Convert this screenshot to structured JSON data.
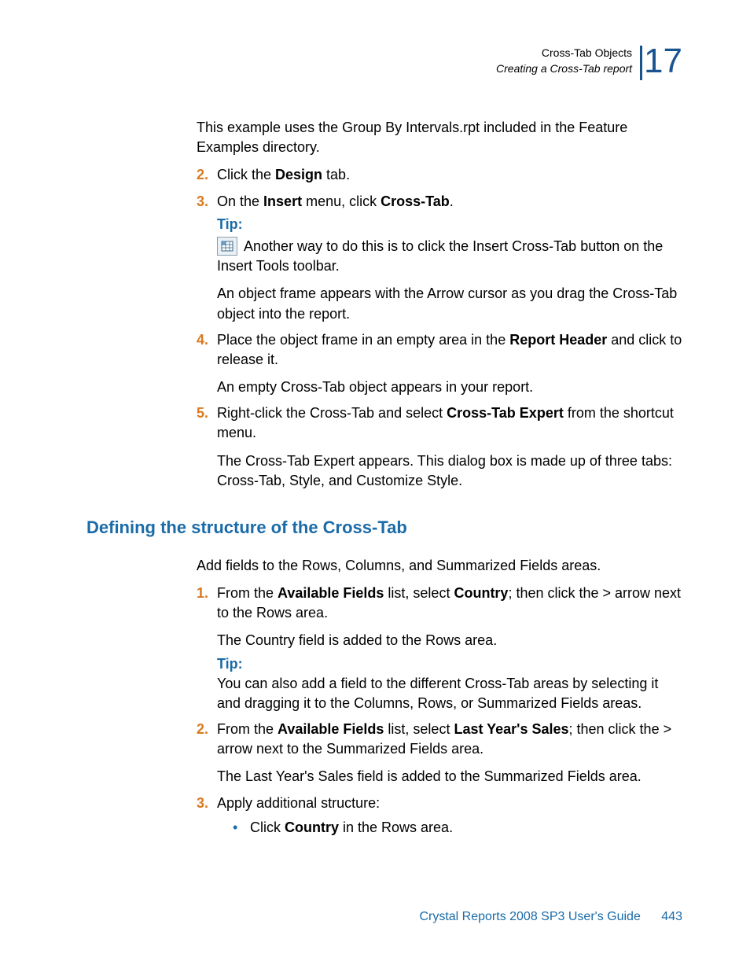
{
  "header": {
    "section": "Cross-Tab Objects",
    "subsection": "Creating a Cross-Tab report",
    "chapter": "17"
  },
  "intro": "This example uses the Group By Intervals.rpt included in the Feature Examples directory.",
  "step2": {
    "num": "2.",
    "pre": "Click the ",
    "bold": "Design",
    "post": " tab."
  },
  "step3": {
    "num": "3.",
    "pre": "On the ",
    "b1": "Insert",
    "mid": " menu, click ",
    "b2": "Cross-Tab",
    "post": "."
  },
  "tip1": {
    "label": "Tip:",
    "body": "Another way to do this is to click the Insert Cross-Tab button on the Insert Tools toolbar."
  },
  "afterTip1": "An object frame appears with the Arrow cursor as you drag the Cross-Tab object into the report.",
  "step4": {
    "num": "4.",
    "pre": "Place the object frame in an empty area in the ",
    "b1": "Report Header",
    "post": " and click to release it."
  },
  "afterStep4": "An empty Cross-Tab object appears in your report.",
  "step5": {
    "num": "5.",
    "pre": "Right-click the Cross-Tab and select ",
    "b1": "Cross-Tab Expert",
    "post": " from the shortcut menu."
  },
  "afterStep5": "The Cross-Tab Expert appears. This dialog box is made up of three tabs: Cross-Tab, Style, and Customize Style.",
  "heading2": "Defining the structure of the Cross-Tab",
  "intro2": "Add fields to the Rows, Columns, and Summarized Fields areas.",
  "s2step1": {
    "num": "1.",
    "pre": "From the ",
    "b1": "Available Fields",
    "mid": " list, select ",
    "b2": "Country",
    "post": "; then click the > arrow next to the Rows area."
  },
  "s2after1": "The Country field is added to the Rows area.",
  "tip2": {
    "label": "Tip:",
    "body": "You can also add a field to the different Cross-Tab areas by selecting it and dragging it to the Columns, Rows, or Summarized Fields areas."
  },
  "s2step2": {
    "num": "2.",
    "pre": "From the ",
    "b1": "Available Fields",
    "mid": " list, select ",
    "b2": "Last Year's Sales",
    "post": "; then click the > arrow next to the Summarized Fields area."
  },
  "s2after2": "The Last Year's Sales field is added to the Summarized Fields area.",
  "s2step3": {
    "num": "3.",
    "text": "Apply additional structure:"
  },
  "bullet": {
    "pre": "Click ",
    "b1": "Country",
    "post": " in the Rows area."
  },
  "footer": {
    "doc": "Crystal Reports 2008 SP3 User's Guide",
    "page": "443"
  }
}
